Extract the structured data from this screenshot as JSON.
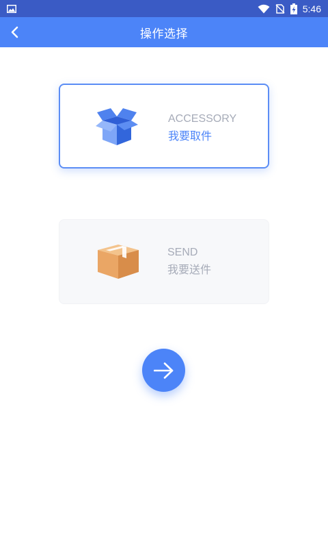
{
  "status_bar": {
    "time": "5:46",
    "icons": [
      "image-icon",
      "wifi-icon",
      "no-sim-icon",
      "battery-charging-icon"
    ]
  },
  "header": {
    "title": "操作选择",
    "back_icon": "chevron-left-icon"
  },
  "options": [
    {
      "en_label": "ACCESSORY",
      "cn_label": "我要取件",
      "icon": "open-box-icon",
      "selected": true,
      "accent_color": "#4c84f8"
    },
    {
      "en_label": "SEND",
      "cn_label": "我要送件",
      "icon": "closed-package-icon",
      "selected": false,
      "accent_color": "#e3a86c"
    }
  ],
  "next_button": {
    "icon": "arrow-right-icon"
  },
  "colors": {
    "status_bar": "#3a5bc5",
    "app_bar": "#4c84f8",
    "muted_text": "#a6abb8"
  }
}
